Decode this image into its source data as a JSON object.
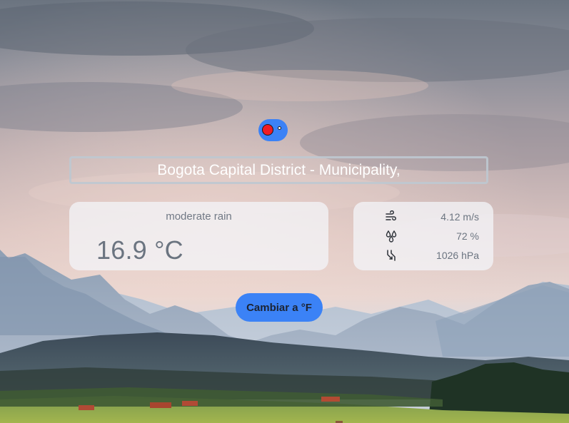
{
  "theme_toggle": {
    "icon": "red-circle-knob-icon",
    "accent": "#3b82f6",
    "knob_color": "#ef1c24"
  },
  "search": {
    "value": "Bogota Capital District - Municipality,"
  },
  "weather": {
    "description": "moderate rain",
    "temperature": "16.9 °C"
  },
  "details": [
    {
      "icon": "wind-icon",
      "value": "4.12 m/s"
    },
    {
      "icon": "humidity-icon",
      "value": "72 %"
    },
    {
      "icon": "pressure-icon",
      "value": "1026 hPa"
    }
  ],
  "unit_button": {
    "label": "Cambiar a °F"
  }
}
